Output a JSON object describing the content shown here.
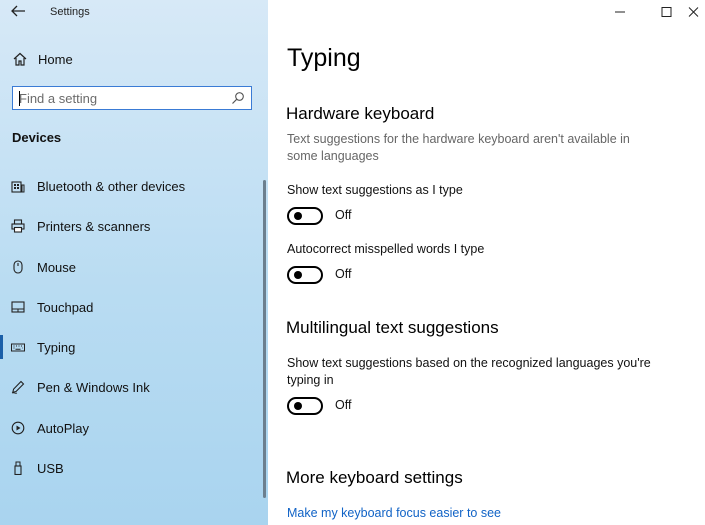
{
  "window": {
    "title": "Settings",
    "controls": {
      "minimize": "—",
      "maximize": "☐",
      "close": "✕"
    }
  },
  "sidebar": {
    "home_label": "Home",
    "search_placeholder": "Find a setting",
    "section": "Devices",
    "items": [
      {
        "label": "Bluetooth & other devices",
        "icon": "bluetooth-devices-icon"
      },
      {
        "label": "Printers & scanners",
        "icon": "printer-icon"
      },
      {
        "label": "Mouse",
        "icon": "mouse-icon"
      },
      {
        "label": "Touchpad",
        "icon": "touchpad-icon"
      },
      {
        "label": "Typing",
        "icon": "keyboard-icon",
        "active": true
      },
      {
        "label": "Pen & Windows Ink",
        "icon": "pen-icon"
      },
      {
        "label": "AutoPlay",
        "icon": "autoplay-icon"
      },
      {
        "label": "USB",
        "icon": "usb-icon"
      }
    ]
  },
  "main": {
    "title": "Typing",
    "hardware": {
      "heading": "Hardware keyboard",
      "note": "Text suggestions for the hardware keyboard aren't available in some languages",
      "setting1": {
        "label": "Show text suggestions as I type",
        "state": "Off"
      },
      "setting2": {
        "label": "Autocorrect misspelled words I type",
        "state": "Off"
      }
    },
    "multilingual": {
      "heading": "Multilingual text suggestions",
      "setting": {
        "label": "Show text suggestions based on the recognized languages you're typing in",
        "state": "Off"
      }
    },
    "more": {
      "heading": "More keyboard settings",
      "link": "Make my keyboard focus easier to see"
    }
  },
  "colors": {
    "accent": "#1b5fa8",
    "link": "#1163c6",
    "sidebar_top": "#d7e9f7",
    "sidebar_bottom": "#a9d4ef"
  }
}
